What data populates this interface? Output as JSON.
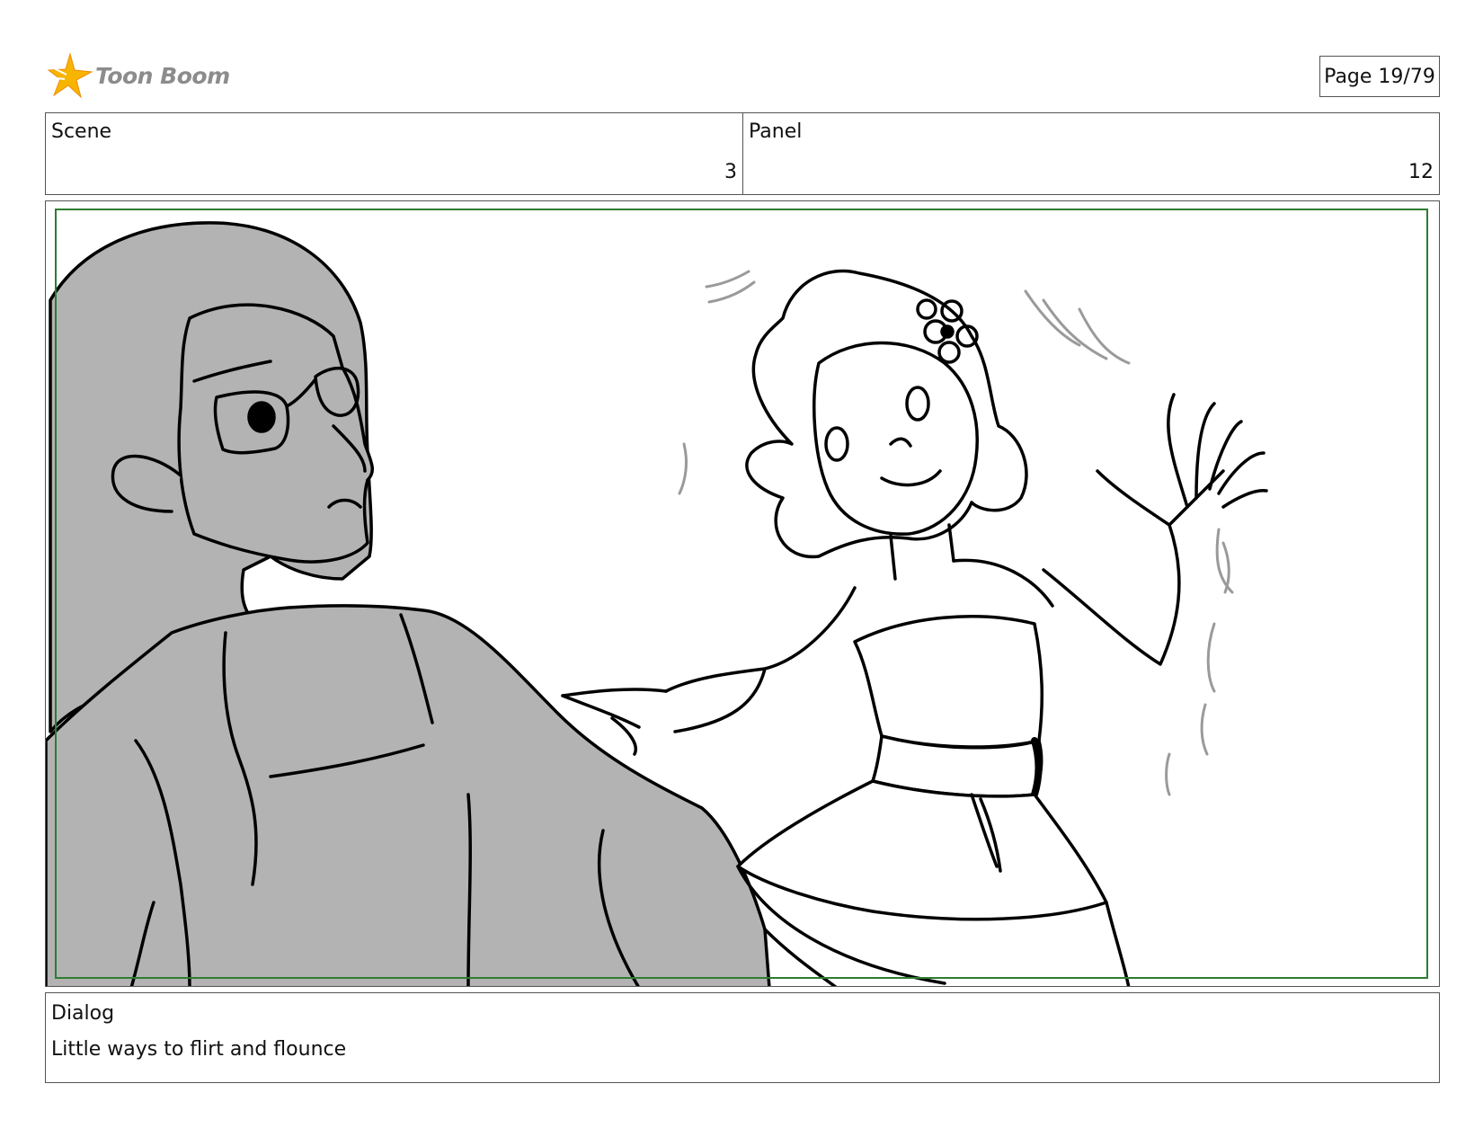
{
  "header": {
    "logo_text": "Toon Boom",
    "page_label": "Page 19/79"
  },
  "info": {
    "scene_label": "Scene",
    "scene_value": "3",
    "panel_label": "Panel",
    "panel_value": "12"
  },
  "frame": {
    "safe_area_color": "#2e7d32",
    "sketch_fill_color": "#b3b3b3",
    "line_color": "#000000",
    "motion_line_color": "#9a9a9a"
  },
  "dialog": {
    "label": "Dialog",
    "text": "Little ways to flirt and flounce"
  },
  "icons": {
    "logo": "toon-boom-star-logo-icon"
  }
}
